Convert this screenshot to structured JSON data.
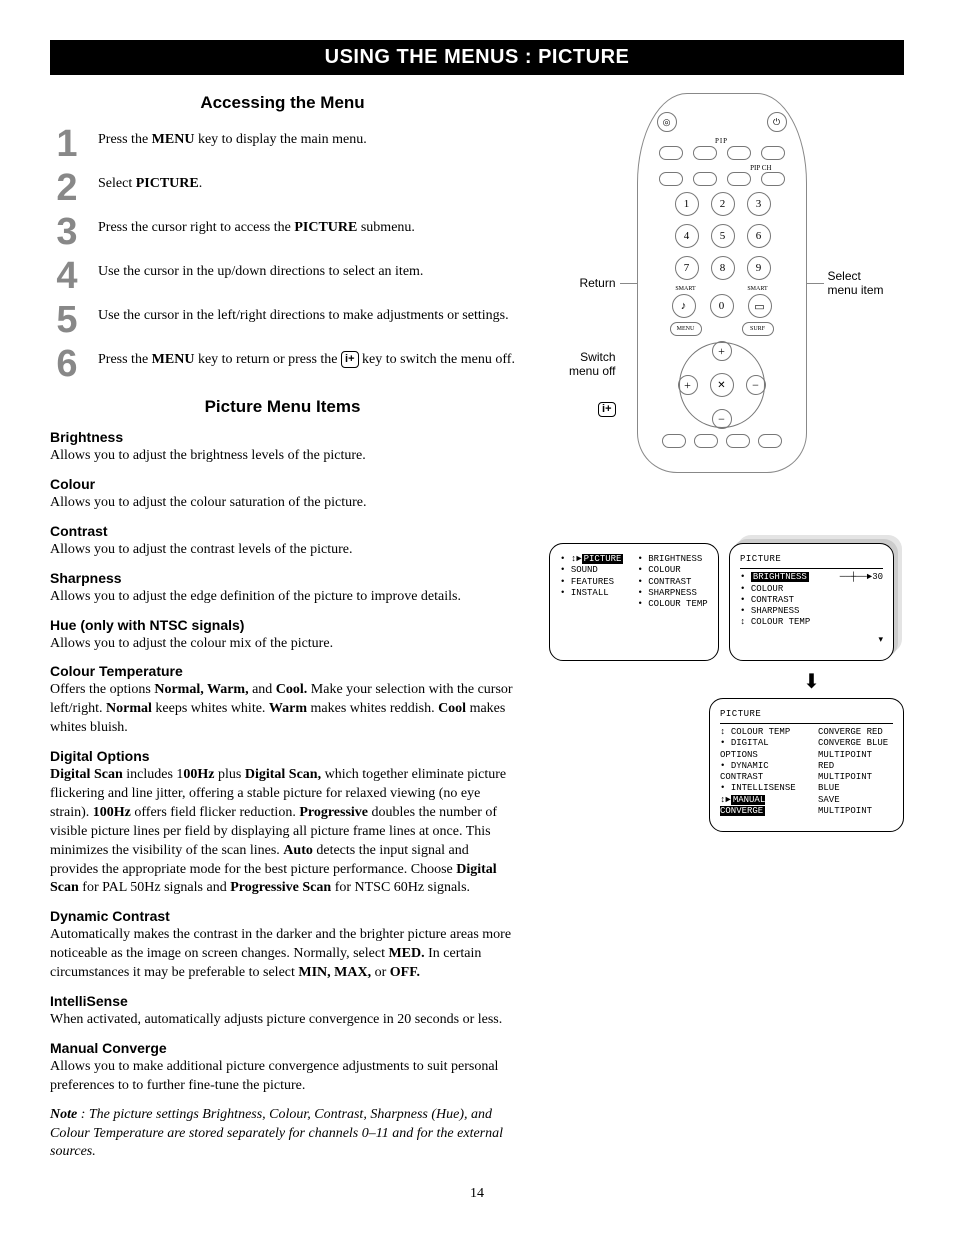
{
  "title_bar": "USING THE MENUS : PICTURE",
  "accessing_head": "Accessing the Menu",
  "steps": {
    "n1": "1",
    "t1a": "Press the ",
    "t1b": "MENU",
    "t1c": " key to display the main menu.",
    "n2": "2",
    "t2a": "Select ",
    "t2b": "PICTURE",
    "t2c": ".",
    "n3": "3",
    "t3a": "Press the cursor right to access the ",
    "t3b": "PICTURE",
    "t3c": " submenu.",
    "n4": "4",
    "t4": "Use the cursor in the up/down directions to select an item.",
    "n5": "5",
    "t5": "Use the cursor in the left/right directions to make adjustments or settings.",
    "n6": "6",
    "t6a": "Press the ",
    "t6b": "MENU",
    "t6c": " key to return or press the ",
    "t6d": "i+",
    "t6e": " key to switch the menu off."
  },
  "picture_items_head": "Picture Menu Items",
  "items": {
    "brightness_h": "Brightness",
    "brightness_b": "Allows you to adjust the brightness levels of the picture.",
    "colour_h": "Colour",
    "colour_b": "Allows you to adjust the colour saturation of the picture.",
    "contrast_h": "Contrast",
    "contrast_b": "Allows you to adjust the contrast levels of the picture.",
    "sharpness_h": "Sharpness",
    "sharpness_b": "Allows you to adjust the edge definition of the picture to improve details.",
    "hue_h": "Hue (only with NTSC signals)",
    "hue_b": "Allows you to adjust the colour mix of the picture.",
    "coltemp_h": "Colour Temperature",
    "coltemp_b1": "Offers the options ",
    "coltemp_b2": "Normal, Warm,",
    "coltemp_b3": " and ",
    "coltemp_b4": "Cool.",
    "coltemp_b5": " Make your selection with the cursor left/right. ",
    "coltemp_b6": "Normal",
    "coltemp_b7": " keeps whites white. ",
    "coltemp_b8": "Warm",
    "coltemp_b9": " makes whites reddish. ",
    "coltemp_b10": "Cool",
    "coltemp_b11": " makes whites bluish.",
    "digopt_h": "Digital Options",
    "digopt_b1": "Digital Scan",
    "digopt_b2": " includes 1",
    "digopt_b3": "00Hz",
    "digopt_b4": " plus ",
    "digopt_b5": "Digital Scan,",
    "digopt_b6": " which together eliminate picture flickering and line jitter, offering a stable picture for relaxed viewing (no eye strain). ",
    "digopt_b7": "100Hz",
    "digopt_b8": " offers field flicker reduction. ",
    "digopt_b9": "Progressive",
    "digopt_b10": " doubles the number of visible picture lines per field by displaying all picture frame lines at once. This minimizes the visibility of the scan lines. ",
    "digopt_b11": "Auto",
    "digopt_b12": " detects the input signal and provides the appropriate mode for the best picture performance. Choose ",
    "digopt_b13": "Digital Scan",
    "digopt_b14": " for PAL 50Hz signals and ",
    "digopt_b15": "Progressive Scan",
    "digopt_b16": " for NTSC 60Hz signals.",
    "dyncon_h": "Dynamic Contrast",
    "dyncon_b1": "Automatically makes the contrast in the darker and the brighter picture areas more noticeable as the image on screen changes. Normally, select ",
    "dyncon_b2": "MED.",
    "dyncon_b3": " In certain circumstances it may be preferable to select ",
    "dyncon_b4": "MIN, MAX,",
    "dyncon_b5": " or ",
    "dyncon_b6": "OFF.",
    "intelli_h": "IntelliSense",
    "intelli_b": "When activated, automatically adjusts picture convergence in 20 seconds or less.",
    "manconv_h": "Manual Converge",
    "manconv_b": "Allows you to make additional picture convergence adjustments to suit personal preferences to to further fine-tune the picture."
  },
  "note_a": "Note",
  "note_b": " : The picture settings Brightness, Colour, Contrast, Sharpness (Hue), and Colour Temperature are stored separately for channels 0–11 and for the external sources.",
  "page_num": "14",
  "remote": {
    "annot_return": "Return",
    "annot_select": "Select menu item",
    "annot_switch": "Switch menu off",
    "iplus": "i+",
    "keys": {
      "k1": "1",
      "k2": "2",
      "k3": "3",
      "k4": "4",
      "k5": "5",
      "k6": "6",
      "k7": "7",
      "k8": "8",
      "k9": "9",
      "k0": "0"
    },
    "menu_btn": "MENU",
    "surf_btn": "SURF",
    "pip": "PIP",
    "pipch": "PIP CH",
    "smart_l": "SMART",
    "smart_r": "SMART"
  },
  "osd": {
    "panel1": {
      "picture": "PICTURE",
      "sound": "SOUND",
      "features": "FEATURES",
      "install": "INSTALL",
      "c_brightness": "BRIGHTNESS",
      "c_colour": "COLOUR",
      "c_contrast": "CONTRAST",
      "c_sharpness": "SHARPNESS",
      "c_coltemp": "COLOUR TEMP"
    },
    "panel2": {
      "title": "PICTURE",
      "brightness": "BRIGHTNESS",
      "value": "30",
      "colour": "COLOUR",
      "contrast": "CONTRAST",
      "sharpness": "SHARPNESS",
      "coltemp": "COLOUR TEMP"
    },
    "panel3": {
      "title": "PICTURE",
      "l_coltemp": "COLOUR TEMP",
      "l_digopt": "DIGITAL OPTIONS",
      "l_dyncon": "DYNAMIC CONTRAST",
      "l_intelli": "INTELLISENSE",
      "l_manconv": "MANUAL CONVERGE",
      "r_convred": "CONVERGE RED",
      "r_convblue": "CONVERGE BLUE",
      "r_mpred": "MULTIPOINT RED",
      "r_mpblue": "MULTIPOINT BLUE",
      "r_savemp": "SAVE MULTIPOINT"
    }
  }
}
